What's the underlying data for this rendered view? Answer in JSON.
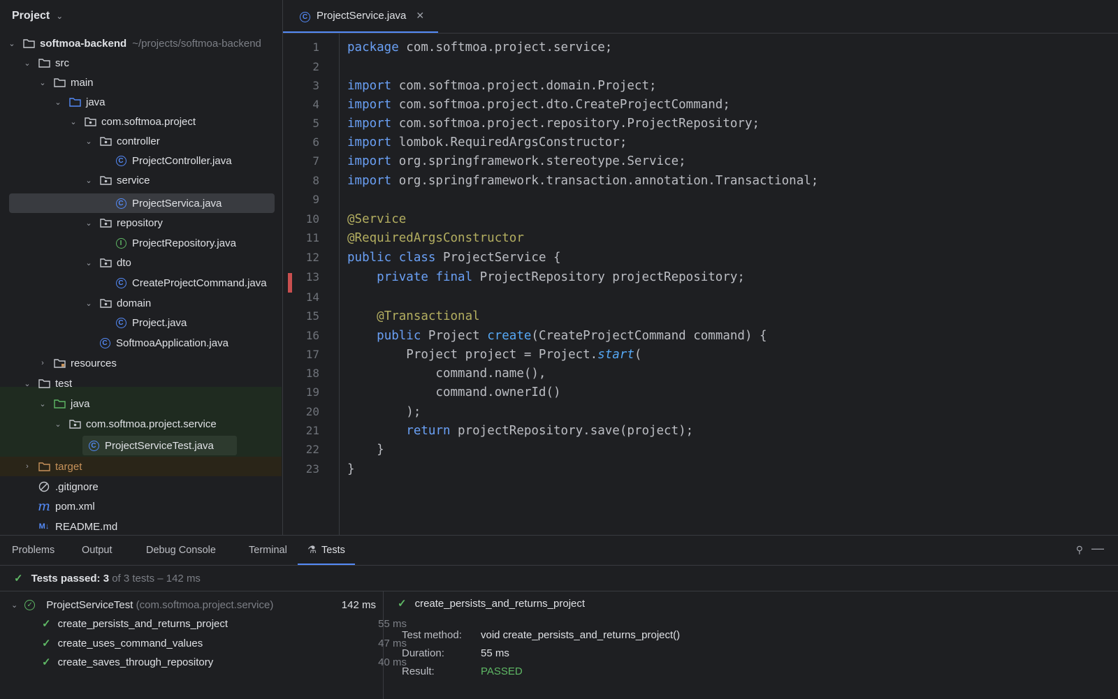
{
  "project_panel": {
    "title": "Project",
    "root": {
      "name": "softmoa-backend",
      "path": "~/projects/softmoa-backend"
    },
    "tree": {
      "src": "src",
      "main": "main",
      "java": "java",
      "pkg": "com.softmoa.project",
      "controller": "controller",
      "controller_file": "ProjectController.java",
      "service": "service",
      "service_file": "ProjectServica.java",
      "repository": "repository",
      "repository_file": "ProjectRepository.java",
      "dto": "dto",
      "dto_file": "CreateProjectCommand.java",
      "domain": "domain",
      "domain_file": "Project.java",
      "app_file": "SoftmoaApplication.java",
      "resources": "resources",
      "test": "test",
      "test_java": "java",
      "test_pkg": "com.softmoa.project.service",
      "test_file": "ProjectServiceTest.java",
      "target": "target",
      "gitignore": ".gitignore",
      "pom": "pom.xml",
      "readme": "README.md"
    }
  },
  "editor": {
    "tab_label": "ProjectService.java",
    "line_numbers": [
      "1",
      "2",
      "3",
      "4",
      "5",
      "6",
      "7",
      "8",
      "9",
      "10",
      "11",
      "12",
      "13",
      "14",
      "15",
      "16",
      "17",
      "18",
      "19",
      "20",
      "21",
      "22",
      "23"
    ],
    "code": {
      "l1_kw": "package",
      "l1_rest": " com.softmoa.project.service;",
      "l3_kw": "import",
      "l3_rest": " com.softmoa.project.domain.Project;",
      "l4_kw": "import",
      "l4_rest": " com.softmoa.project.dto.CreateProjectCommand;",
      "l5_kw": "import",
      "l5_rest": " com.softmoa.project.repository.ProjectRepository;",
      "l6_kw": "import",
      "l6_rest": " lombok.RequiredArgsConstructor;",
      "l7_kw": "import",
      "l7_rest": " org.springframework.stereotype.Service;",
      "l8_kw": "import",
      "l8_rest": " org.springframework.transaction.annotation.Transactional;",
      "l10": "@Service",
      "l11": "@RequiredArgsConstructor",
      "l12_kw": "public class",
      "l12_rest": " ProjectService {",
      "l13_indent": "    ",
      "l13_kw": "private final",
      "l13_rest": " ProjectRepository projectRepository;",
      "l15_indent": "    ",
      "l15_an": "@Transactional",
      "l16_indent": "    ",
      "l16_kw": "public",
      "l16_a": " Project ",
      "l16_fn": "create",
      "l16_b": "(CreateProjectCommand command) {",
      "l17_a": "        Project project = Project.",
      "l17_fn": "start",
      "l17_b": "(",
      "l18": "            command.name(),",
      "l19": "            command.ownerId()",
      "l20": "        );",
      "l21_indent": "        ",
      "l21_kw": "return",
      "l21_rest": " projectRepository.save(project);",
      "l22": "    }",
      "l23": "}"
    }
  },
  "bottom": {
    "tabs": [
      "Problems",
      "Output",
      "Debug Console",
      "Terminal",
      "Tests"
    ],
    "summary": {
      "label": "Tests passed:",
      "passed": "3",
      "rest": "of 3 tests – 142 ms"
    },
    "suite": {
      "name": "ProjectServiceTest",
      "package": "(com.softmoa.project.service)",
      "duration": "142 ms"
    },
    "tests": [
      {
        "name": "create_persists_and_returns_project",
        "duration": "55 ms"
      },
      {
        "name": "create_uses_command_values",
        "duration": "47 ms"
      },
      {
        "name": "create_saves_through_repository",
        "duration": "40 ms"
      }
    ],
    "details": {
      "title": "create_persists_and_returns_project",
      "method_label": "Test method:",
      "method_value": "void create_persists_and_returns_project()",
      "duration_label": "Duration:",
      "duration_value": "55 ms",
      "result_label": "Result:",
      "result_value": "PASSED"
    }
  },
  "colors": {
    "accent": "#548af7",
    "pass": "#5fb865",
    "keyword": "#6aa0f5",
    "annotation": "#b3ae60",
    "change_marker": "#c94f4f"
  }
}
